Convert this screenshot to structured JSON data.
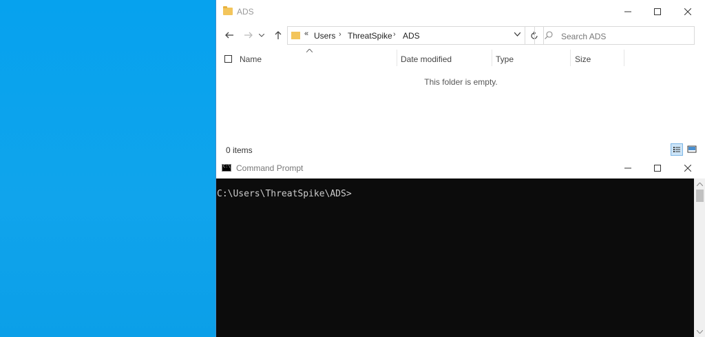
{
  "explorer": {
    "title": "ADS",
    "address": {
      "chevron": "«",
      "crumbs": [
        "Users",
        "ThreatSpike",
        "ADS"
      ]
    },
    "search_placeholder": "Search ADS",
    "columns": {
      "name": "Name",
      "date_modified": "Date modified",
      "type": "Type",
      "size": "Size"
    },
    "empty_message": "This folder is empty.",
    "status": "0 items"
  },
  "cmd": {
    "title": "Command Prompt",
    "prompt": "C:\\Users\\ThreatSpike\\ADS>"
  },
  "colors": {
    "desktop": "#0aa0ec",
    "console_bg": "#0c0c0c",
    "console_text": "#cccccc",
    "folder": "#f3c55b"
  }
}
